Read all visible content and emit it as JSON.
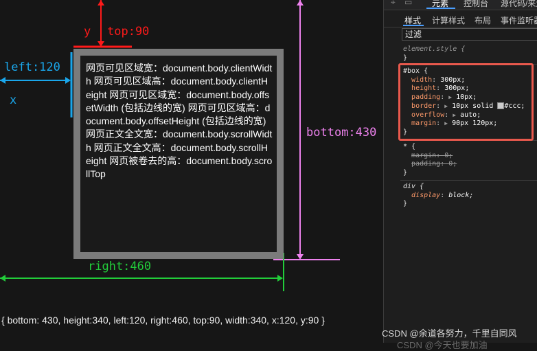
{
  "annotations": {
    "top_label": "top:90",
    "y_label": "y",
    "left_label": "left:120",
    "x_label": "x",
    "bottom_label": "bottom:430",
    "right_label": "right:460"
  },
  "box_text": "网页可见区域宽：document.body.clientWidth 网页可见区域高：document.body.clientHeight 网页可见区域宽：document.body.offsetWidth (包括边线的宽) 网页可见区域高：document.body.offsetHeight (包括边线的宽) 网页正文全文宽：document.body.scrollWidth 网页正文全文高：document.body.scrollHeight 网页被卷去的高：document.body.scrollTop",
  "result_text": "{ bottom: 430, height:340, left:120, right:460, top:90, width:340, x:120, y:90 }",
  "devtools": {
    "top_tabs": [
      "元素",
      "控制台",
      "源代码/来源"
    ],
    "sub_tabs": [
      "样式",
      "计算样式",
      "布局",
      "事件监听器"
    ],
    "filter_placeholder": "过滤",
    "element_style": "element.style {",
    "box_rule": {
      "selector": "#box {",
      "decls": [
        {
          "prop": "width",
          "val": "300px;"
        },
        {
          "prop": "height",
          "val": "300px;"
        },
        {
          "prop": "padding",
          "val": "10px;"
        },
        {
          "prop": "border",
          "val": "10px solid",
          "val2": "#ccc;"
        },
        {
          "prop": "overflow",
          "val": "auto;"
        },
        {
          "prop": "margin",
          "val": "90px 120px;"
        }
      ]
    },
    "star_rule": {
      "selector": "* {",
      "decls": [
        {
          "prop": "margin",
          "val": "0;"
        },
        {
          "prop": "padding",
          "val": "0;"
        }
      ]
    },
    "div_rule": {
      "selector": "div {",
      "decls": [
        {
          "prop": "display",
          "val": "block;"
        }
      ]
    },
    "close_brace": "}"
  },
  "watermark": "CSDN @余道各努力，千里自同风",
  "watermark2": "CSDN @今天也要加油",
  "colors": {
    "red": "#ff1a1a",
    "blue": "#1aa7ec",
    "violet": "#ee82ee",
    "green": "#22cc3a",
    "highlight": "#e9594d"
  }
}
